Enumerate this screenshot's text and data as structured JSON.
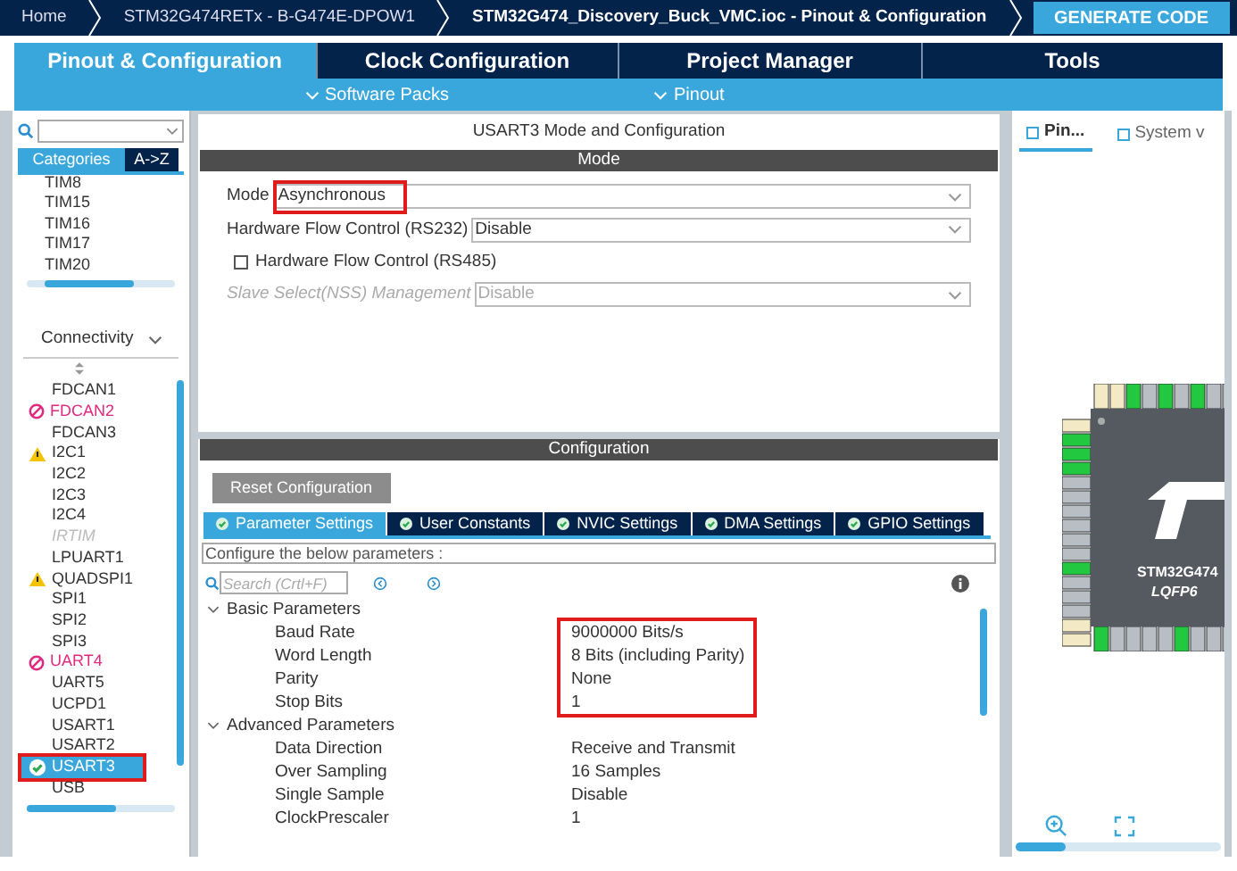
{
  "breadcrumbs": [
    {
      "label": "Home"
    },
    {
      "label": "STM32G474RETx  -  B-G474E-DPOW1"
    },
    {
      "label": "STM32G474_Discovery_Buck_VMC.ioc - Pinout & Configuration"
    }
  ],
  "generate_button": "GENERATE CODE",
  "main_tabs": [
    {
      "label": "Pinout & Configuration",
      "selected": true
    },
    {
      "label": "Clock Configuration",
      "selected": false
    },
    {
      "label": "Project Manager",
      "selected": false
    },
    {
      "label": "Tools",
      "selected": false
    }
  ],
  "sub_menus": [
    {
      "label": "Software Packs"
    },
    {
      "label": "Pinout"
    }
  ],
  "sidebar": {
    "tabs": [
      {
        "label": "Categories",
        "selected": true
      },
      {
        "label": "A->Z",
        "selected": false
      }
    ],
    "timers": [
      {
        "label": "TIM8"
      },
      {
        "label": "TIM15"
      },
      {
        "label": "TIM16"
      },
      {
        "label": "TIM17"
      },
      {
        "label": "TIM20"
      }
    ],
    "category": "Connectivity",
    "items": [
      {
        "label": "FDCAN1",
        "kind": "plain",
        "disabled": false,
        "selected": false
      },
      {
        "label": "FDCAN2",
        "kind": "error",
        "disabled": false,
        "selected": false
      },
      {
        "label": "FDCAN3",
        "kind": "plain",
        "disabled": false,
        "selected": false
      },
      {
        "label": "I2C1",
        "kind": "warning",
        "disabled": false,
        "selected": false
      },
      {
        "label": "I2C2",
        "kind": "plain",
        "disabled": false,
        "selected": false
      },
      {
        "label": "I2C3",
        "kind": "plain",
        "disabled": false,
        "selected": false
      },
      {
        "label": "I2C4",
        "kind": "plain",
        "disabled": false,
        "selected": false
      },
      {
        "label": "IRTIM",
        "kind": "plain",
        "disabled": true,
        "selected": false
      },
      {
        "label": "LPUART1",
        "kind": "plain",
        "disabled": false,
        "selected": false
      },
      {
        "label": "QUADSPI1",
        "kind": "warning",
        "disabled": false,
        "selected": false
      },
      {
        "label": "SPI1",
        "kind": "plain",
        "disabled": false,
        "selected": false
      },
      {
        "label": "SPI2",
        "kind": "plain",
        "disabled": false,
        "selected": false
      },
      {
        "label": "SPI3",
        "kind": "plain",
        "disabled": false,
        "selected": false
      },
      {
        "label": "UART4",
        "kind": "error",
        "disabled": false,
        "selected": false
      },
      {
        "label": "UART5",
        "kind": "plain",
        "disabled": false,
        "selected": false
      },
      {
        "label": "UCPD1",
        "kind": "plain",
        "disabled": false,
        "selected": false
      },
      {
        "label": "USART1",
        "kind": "plain",
        "disabled": false,
        "selected": false
      },
      {
        "label": "USART2",
        "kind": "plain",
        "disabled": false,
        "selected": false
      },
      {
        "label": "USART3",
        "kind": "ok",
        "disabled": false,
        "selected": true
      },
      {
        "label": "USB",
        "kind": "plain",
        "disabled": false,
        "selected": false
      }
    ]
  },
  "mode_panel": {
    "title": "USART3 Mode and Configuration",
    "section": "Mode",
    "fields": [
      {
        "kind": "select",
        "label": "Mode",
        "value": "Asynchronous",
        "disabled": false,
        "highlighted": true
      },
      {
        "kind": "select",
        "label": "Hardware Flow Control (RS232)",
        "value": "Disable",
        "disabled": false,
        "highlighted": false
      },
      {
        "kind": "checkbox",
        "label": "Hardware Flow Control (RS485)",
        "checked": false
      },
      {
        "kind": "select",
        "label": "Slave Select(NSS) Management",
        "value": "Disable",
        "disabled": true,
        "highlighted": false
      }
    ]
  },
  "config_panel": {
    "section": "Configuration",
    "reset_button": "Reset Configuration",
    "tabs": [
      {
        "label": "Parameter Settings",
        "selected": true
      },
      {
        "label": "User Constants",
        "selected": false
      },
      {
        "label": "NVIC Settings",
        "selected": false
      },
      {
        "label": "DMA Settings",
        "selected": false
      },
      {
        "label": "GPIO Settings",
        "selected": false
      }
    ],
    "hint": "Configure the below parameters :",
    "search": {
      "placeholder": "Search (Crtl+F)"
    },
    "groups": [
      {
        "title": "Basic Parameters",
        "expanded": true,
        "highlighted": true,
        "params": [
          {
            "name": "Baud Rate",
            "value": "9000000 Bits/s"
          },
          {
            "name": "Word Length",
            "value": "8 Bits (including Parity)"
          },
          {
            "name": "Parity",
            "value": "None"
          },
          {
            "name": "Stop Bits",
            "value": "1"
          }
        ]
      },
      {
        "title": "Advanced Parameters",
        "expanded": true,
        "highlighted": false,
        "params": [
          {
            "name": "Data Direction",
            "value": "Receive and Transmit"
          },
          {
            "name": "Over Sampling",
            "value": "16 Samples"
          },
          {
            "name": "Single Sample",
            "value": "Disable"
          },
          {
            "name": "ClockPrescaler",
            "value": "1"
          }
        ]
      }
    ]
  },
  "pinout_panel": {
    "tabs": [
      {
        "label": "Pin...",
        "selected": true
      },
      {
        "label": "System v",
        "selected": false
      }
    ],
    "chip_name": "STM32G474",
    "package": "LQFP6"
  }
}
